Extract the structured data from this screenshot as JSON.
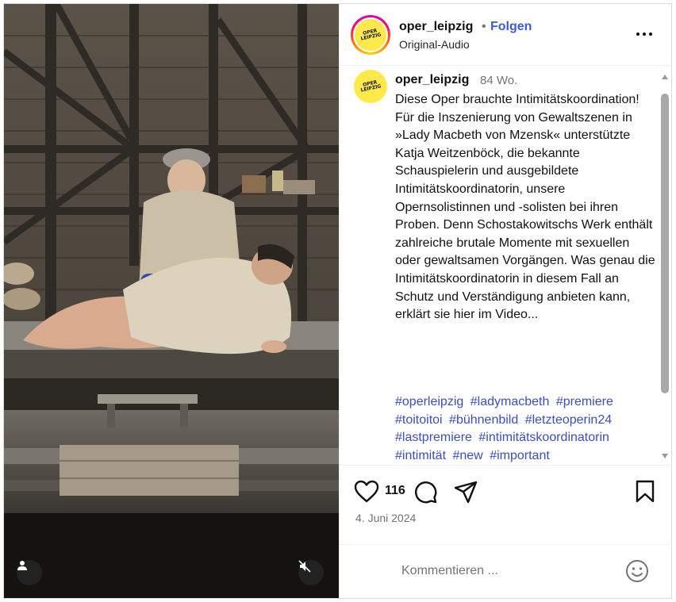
{
  "header": {
    "username": "oper_leipzig",
    "separator": "•",
    "follow_label": "Folgen",
    "audio_label": "Original-Audio",
    "more_icon": "more-horizontal-icon"
  },
  "logo": {
    "line1": "OPER",
    "line2": "LEIPZIG"
  },
  "caption": {
    "username": "oper_leipzig",
    "time": "84 Wo.",
    "text": "Diese Oper brauchte Intimitätskoordination! Für die Inszenierung von Gewaltszenen in »Lady Macbeth von Mzensk« unterstützte Katja Weitzenböck, die bekannte Schauspielerin und ausgebildete Intimitätskoordinatorin, unsere Opernsolistinnen und -solisten bei ihren Proben. Denn Schostakowitschs Werk enthält zahlreiche brutale Momente mit sexuellen oder gewaltsamen Vorgängen. Was genau die Intimitätskoordinatorin in diesem Fall an Schutz und Verständigung anbieten kann, erklärt sie hier im Video...",
    "hashtags": [
      "#operleipzig",
      "#ladymacbeth",
      "#premiere",
      "#toitoitoi",
      "#bühnenbild",
      "#letzteoperin24",
      "#lastpremiere",
      "#intimitätskoordinatorin",
      "#intimität",
      "#new",
      "#important"
    ]
  },
  "actions": {
    "likes": "116",
    "date": "4. Juni 2024"
  },
  "comment": {
    "placeholder": "Kommentieren ..."
  },
  "colors": {
    "link": "#3b5bdb",
    "hashtag": "#3b4fb8",
    "logo_yellow": "#ffe94a",
    "muted": "#737373"
  },
  "icons": [
    "user-tag-icon",
    "mute-icon",
    "heart-icon",
    "comment-icon",
    "share-icon",
    "bookmark-icon",
    "emoji-icon"
  ]
}
